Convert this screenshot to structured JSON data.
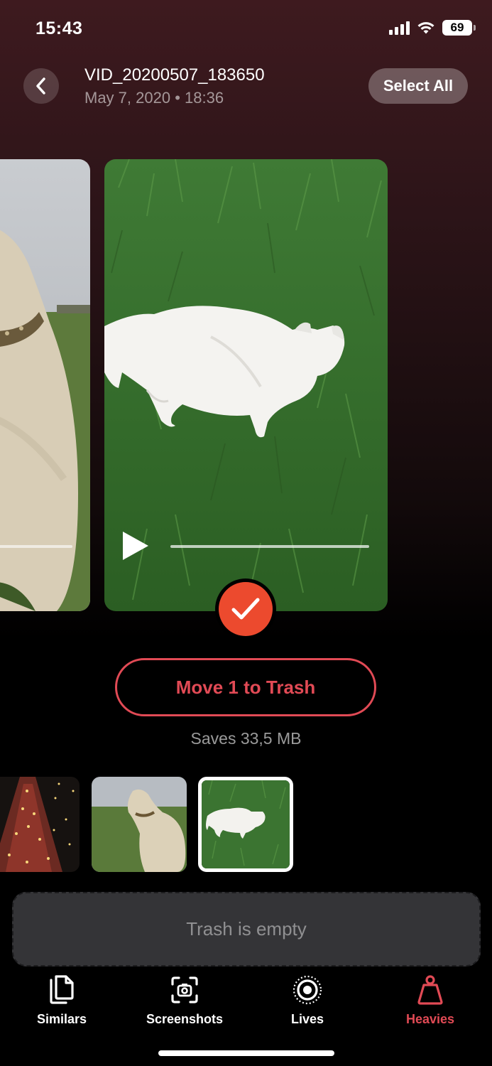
{
  "status_bar": {
    "time": "15:43",
    "battery": "69"
  },
  "header": {
    "title": "VID_20200507_183650",
    "subtitle": "May 7, 2020 • 18:36",
    "select_all_label": "Select All"
  },
  "action": {
    "trash_button_label": "Move 1 to Trash",
    "saves_text": "Saves 33,5 MB"
  },
  "trash_area": {
    "label": "Trash is empty"
  },
  "tab_bar": {
    "items": [
      {
        "label": "Similars",
        "icon": "similars-icon"
      },
      {
        "label": "Screenshots",
        "icon": "screenshots-icon"
      },
      {
        "label": "Lives",
        "icon": "lives-icon"
      },
      {
        "label": "Heavies",
        "icon": "heavies-icon",
        "active": true
      }
    ]
  },
  "colors": {
    "accent": "#e14a55",
    "check": "#ec4a2e",
    "background_top": "#3e1a1f"
  }
}
